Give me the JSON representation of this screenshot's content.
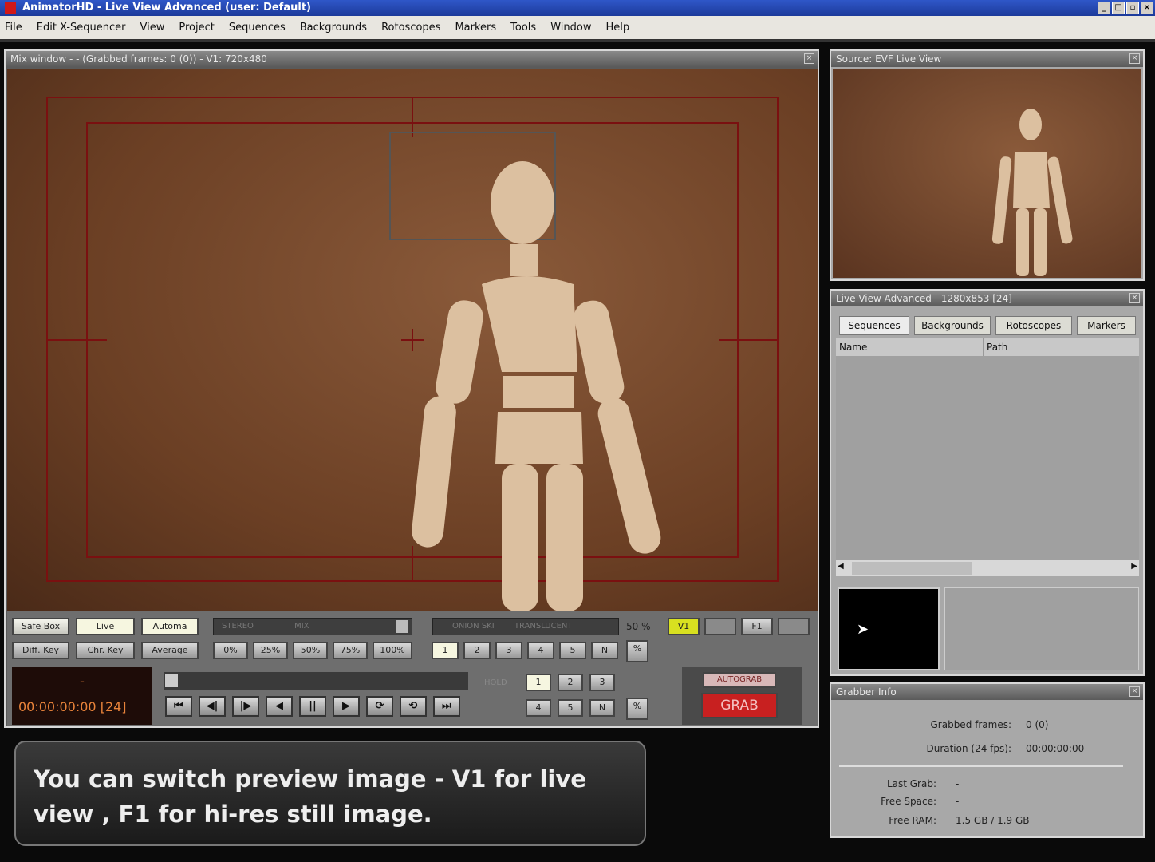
{
  "window": {
    "title": "AnimatorHD - Live View Advanced    (user: Default)"
  },
  "menu": [
    "File",
    "Edit X-Sequencer",
    "View",
    "Project",
    "Sequences",
    "Backgrounds",
    "Rotoscopes",
    "Markers",
    "Tools",
    "Window",
    "Help"
  ],
  "mix_window": {
    "title": "Mix window - - (Grabbed frames: 0 (0)) - V1: 720x480",
    "buttons_row1": [
      "Safe Box",
      "Live",
      "Automa"
    ],
    "buttons_row2": [
      "Diff. Key",
      "Chr. Key",
      "Average"
    ],
    "stereo_slider": {
      "left": "STEREO",
      "right": "MIX"
    },
    "opacity_buttons": [
      "0%",
      "25%",
      "50%",
      "75%",
      "100%"
    ],
    "onion_slider": {
      "left": "ONION SKI",
      "right": "TRANSLUCENT"
    },
    "onion_percent": "50 %",
    "onion_frames": [
      "1",
      "2",
      "3",
      "4",
      "5",
      "N"
    ],
    "view_buttons": [
      "V1",
      "",
      "F1",
      ""
    ],
    "timecode_dash": "-",
    "timecode": "00:00:00:00 [24]",
    "transport": [
      "⏮",
      "◀|",
      "|▶",
      "◀",
      "||",
      "▶",
      "⟳",
      "⟲",
      "⏭"
    ],
    "hold_label": "HOLD",
    "hold_row1": [
      "1",
      "2",
      "3"
    ],
    "hold_row2": [
      "4",
      "5",
      "N"
    ],
    "autograb_label": "AUTOGRAB",
    "grab_label": "GRAB"
  },
  "source_panel": {
    "title": "Source: EVF Live View"
  },
  "live_view_panel": {
    "title": "Live View Advanced - 1280x853 [24]",
    "tabs": [
      "Sequences",
      "Backgrounds",
      "Rotoscopes",
      "Markers"
    ],
    "columns": [
      "Name",
      "Path"
    ]
  },
  "grabber_info": {
    "title": "Grabber Info",
    "rows": [
      {
        "label": "Grabbed frames:",
        "value": "0 (0)"
      },
      {
        "label": "Duration (24 fps):",
        "value": "00:00:00:00"
      },
      {
        "label": "Last Grab:",
        "value": "-"
      },
      {
        "label": "Free Space:",
        "value": "-"
      },
      {
        "label": "Free RAM:",
        "value": "1.5 GB / 1.9 GB"
      }
    ]
  },
  "caption": "You can switch preview image - V1 for live view , F1 for hi-res still image.",
  "colors": {
    "grab": "#c82020",
    "v1_active": "#d8e020",
    "timecode": "#e8833a"
  }
}
